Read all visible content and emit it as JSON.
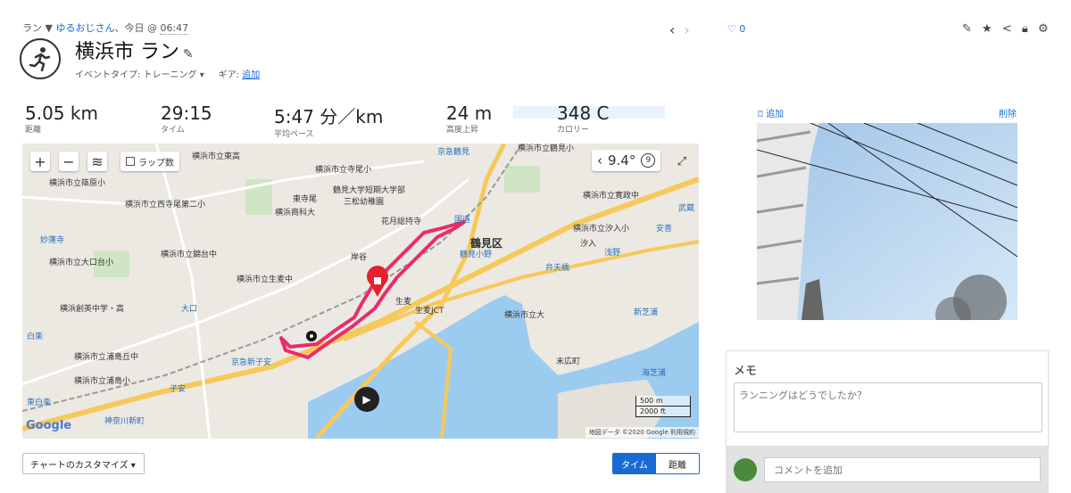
{
  "header": {
    "activity_type": "ラン ▼",
    "user": "ゆるおじさん",
    "sep": "、今日 @",
    "time": "06:47",
    "title": "横浜市 ラン",
    "event_type_label": "イベントタイプ: トレーニング ▾",
    "gear_label": "ギア:",
    "gear_link": "追加",
    "like_count": "♡ 0"
  },
  "stats": [
    {
      "value": "5.05 km",
      "label": "距離"
    },
    {
      "value": "29:15",
      "label": "タイム"
    },
    {
      "value": "5:47 分／km",
      "label": "平均ペース"
    },
    {
      "value": "24 m",
      "label": "高度上昇"
    },
    {
      "value": "348 C",
      "label": "カロリー"
    }
  ],
  "map": {
    "laps_label": "ラップ数",
    "temperature": "9.4°",
    "wind": "9",
    "scale_m": "500 m",
    "scale_ft": "2000 ft",
    "google": "Google",
    "attribution": "地図データ ©2020 Google   利用規約",
    "labels": {
      "tsurumi": "鶴見区",
      "l1": "横浜市立東高",
      "l2": "横浜市立寺尾小",
      "l3": "横浜市立篠原小",
      "l4": "横浜市立西寺尾第二小",
      "l5": "鶴見大学短期大学部",
      "l6": "横浜商科大",
      "l7": "花月総持寺",
      "l8": "国道",
      "l9": "横浜市立寛政中",
      "l10": "横浜市立汐入小",
      "l11": "妙蓮寺",
      "l12": "横浜市立錦台中",
      "l13": "横浜市立大口台小",
      "l14": "横浜市立生麦中",
      "l15": "鶴見小野",
      "l16": "弁天橋",
      "l17": "浅野",
      "l18": "横浜創英中学・高",
      "l19": "大口",
      "l20": "生麦JCT",
      "l21": "横浜市立大",
      "l22": "新芝浦",
      "l23": "白楽",
      "l24": "京急新子安",
      "l25": "横浜市立浦島丘中",
      "l26": "末広町",
      "l27": "海芝浦",
      "l28": "横浜市立浦島小",
      "l29": "子安",
      "l30": "東白楽",
      "l31": "神奈川新町",
      "l32": "京急鶴見",
      "l33": "横浜市立鶴見小",
      "l34": "岸谷",
      "l35": "生麦",
      "l36": "安善",
      "l37": "武蔵",
      "l38": "汐入",
      "l39": "東寺尾",
      "l40": "三松幼稚園"
    }
  },
  "bottom": {
    "customize_label": "チャートのカスタマイズ ▾",
    "seg_time": "タイム",
    "seg_distance": "距離"
  },
  "right": {
    "add_photo": "追加",
    "delete": "削除",
    "memo_title": "メモ",
    "memo_placeholder": "ランニングはどうでしたか？",
    "comment_placeholder": "コメントを追加"
  }
}
